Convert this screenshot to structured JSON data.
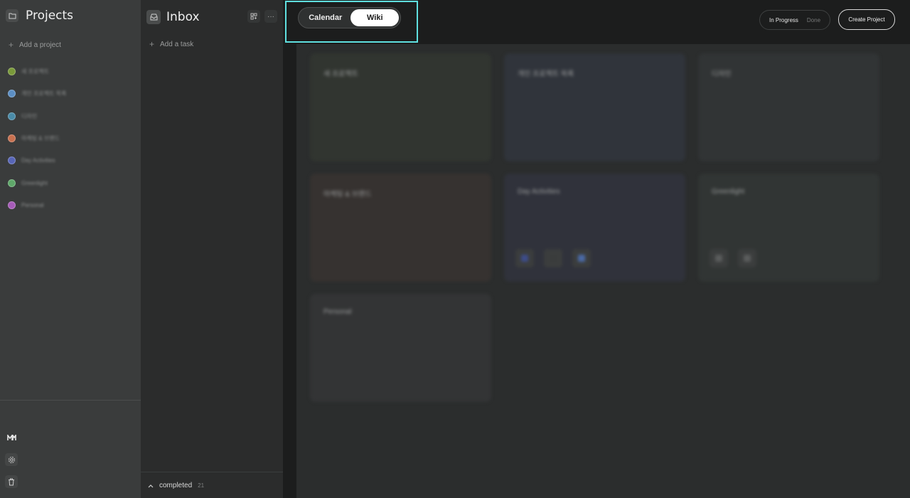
{
  "sidebar": {
    "title": "Projects",
    "add_project": "Add a project",
    "projects": [
      {
        "label": "새 프로젝트",
        "color": "#7a9a3a"
      },
      {
        "label": "개인 프로젝트 목록",
        "color": "#5c8fc4"
      },
      {
        "label": "디자인",
        "color": "#4a8ba8"
      },
      {
        "label": "마케팅 & 브랜드",
        "color": "#c87150"
      },
      {
        "label": "Day Activities",
        "color": "#5866b8"
      },
      {
        "label": "Greenlight",
        "color": "#5fa86a"
      },
      {
        "label": "Personal",
        "color": "#a65cb8"
      }
    ]
  },
  "inbox": {
    "title": "Inbox",
    "add_task": "Add a task",
    "completed_label": "completed",
    "completed_count": "21"
  },
  "topbar": {
    "view_toggle": {
      "calendar": "Calendar",
      "wiki": "Wiki",
      "active": "Wiki"
    },
    "status_filter": {
      "in_progress": "In Progress",
      "done": "Done"
    },
    "create_project": "Create Project"
  },
  "cards": [
    {
      "title": "새 프로젝트",
      "tint": "#313530",
      "chips": []
    },
    {
      "title": "개인 프로젝트 목록",
      "tint": "#30343b",
      "chips": []
    },
    {
      "title": "디자인",
      "tint": "#313435",
      "chips": []
    },
    {
      "title": "마케팅 & 브랜드",
      "tint": "#363230",
      "chips": []
    },
    {
      "title": "Day Activities",
      "tint": "#30323b",
      "chips": [
        "#3d4c8a",
        "#3a3c3c",
        "#4a6aa6"
      ]
    },
    {
      "title": "Greenlight",
      "tint": "#313534",
      "chips": [
        "#5a5c5c",
        "#5a5c5c"
      ]
    },
    {
      "title": "Personal",
      "tint": "#333435",
      "chips": []
    }
  ]
}
